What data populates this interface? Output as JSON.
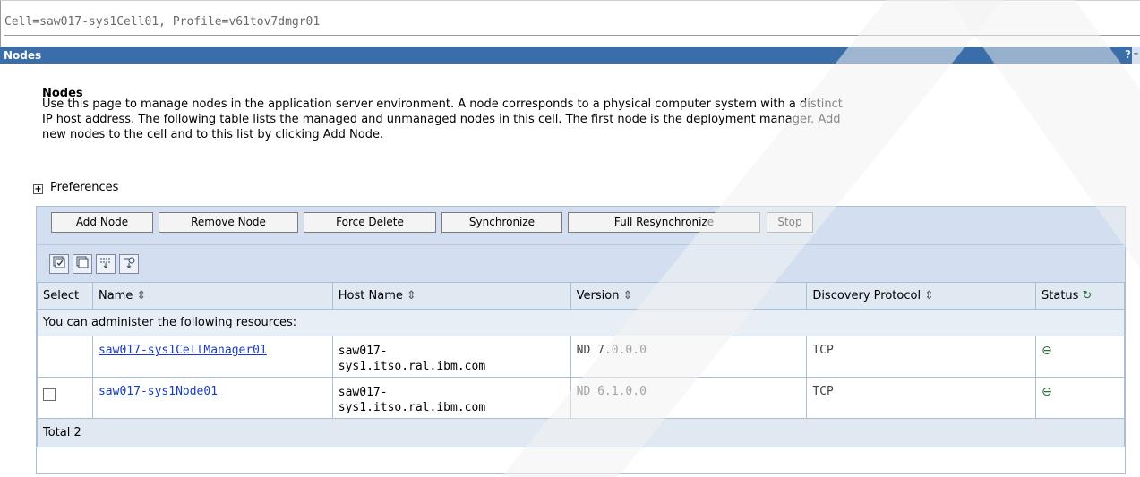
{
  "cell_header": "Cell=saw017-sys1Cell01, Profile=v61tov7dmgr01",
  "window": {
    "title": "Nodes",
    "help_label": "?",
    "minimize_label": "–"
  },
  "page": {
    "heading": "Nodes",
    "description_lines": [
      "Use this page to manage nodes in the application server environment. A node corresponds to a physical computer system with a distinct",
      "IP host address. The following table lists the managed and unmanaged nodes in this cell. The first node is the deployment manager. Add",
      "new nodes to the cell and to this list by clicking Add Node."
    ],
    "preferences_label": "Preferences",
    "preferences_toggle": "+"
  },
  "toolbar": {
    "buttons": [
      "Add Node",
      "Remove Node",
      "Force Delete",
      "Synchronize",
      "Full Resynchronize",
      "Stop"
    ]
  },
  "icon_toolbar": {
    "icons": [
      "select-all-icon",
      "deselect-all-icon",
      "show-filter-icon",
      "clear-filter-icon"
    ]
  },
  "table": {
    "headers": [
      "Select",
      "Name",
      "Host Name",
      "Version",
      "Discovery Protocol",
      "Status"
    ],
    "caption": "You can administer the following resources:",
    "rows": [
      {
        "name": "saw017-sys1CellManager01",
        "host_line1": "saw017-",
        "host_line2": "sys1.itso.ral.ibm.com",
        "version": "ND 7.0.0.0",
        "protocol": "TCP",
        "has_checkbox": false
      },
      {
        "name": "saw017-sys1Node01",
        "host_line1": "saw017-",
        "host_line2": "sys1.itso.ral.ibm.com",
        "version": "ND 6.1.0.0",
        "protocol": "TCP",
        "has_checkbox": true
      }
    ],
    "footer": "Total 2"
  },
  "colors": {
    "title_bar": "#3b6ea8",
    "toolbar_bg": "#d3dff0",
    "link": "#1a3cc2"
  }
}
